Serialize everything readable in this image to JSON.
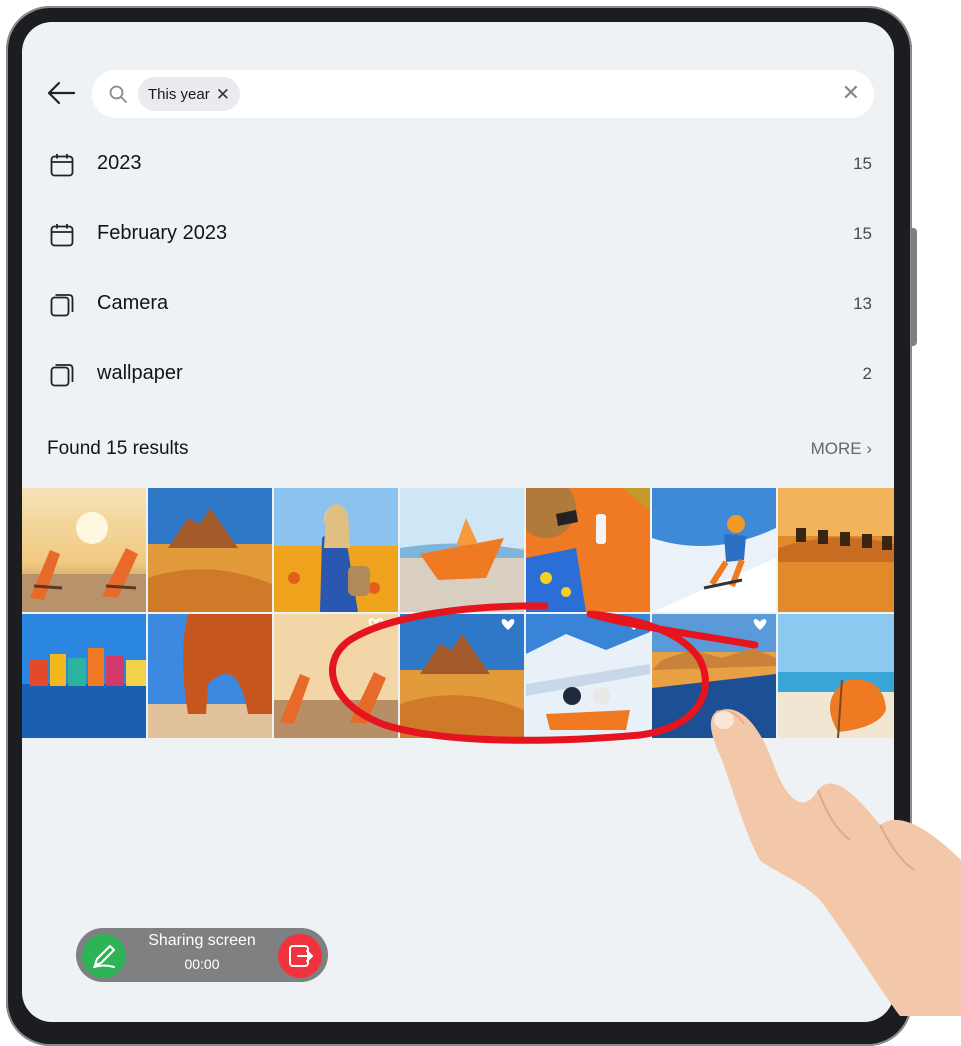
{
  "search": {
    "chip_label": "This year",
    "chip_remove": "✕",
    "clear": "✕"
  },
  "suggestions": [
    {
      "label": "2023",
      "count": "15",
      "icon": "calendar-icon"
    },
    {
      "label": "February 2023",
      "count": "15",
      "icon": "calendar-icon"
    },
    {
      "label": "Camera",
      "count": "13",
      "icon": "album-icon"
    },
    {
      "label": "wallpaper",
      "count": "2",
      "icon": "album-icon"
    }
  ],
  "results": {
    "title": "Found 15 results",
    "more": "MORE"
  },
  "photos": [
    "beach-chairs-sunset",
    "desert-rock",
    "woman-flower-field",
    "paper-boat",
    "beach-hat-flatlay",
    "skier",
    "camel-caravan",
    "colorful-houses-water",
    "red-rock-arch",
    "beach-chairs-sunset-2",
    "desert-rock-2",
    "skiers-snow-mountain",
    "desert-lake",
    "orange-umbrella-beach"
  ],
  "sharing": {
    "title": "Sharing screen",
    "time": "00:00"
  },
  "colors": {
    "screen_bg": "#eff2f5",
    "share_green": "#2eb356",
    "share_red": "#f0333d",
    "annotation_red": "#e5141e"
  }
}
